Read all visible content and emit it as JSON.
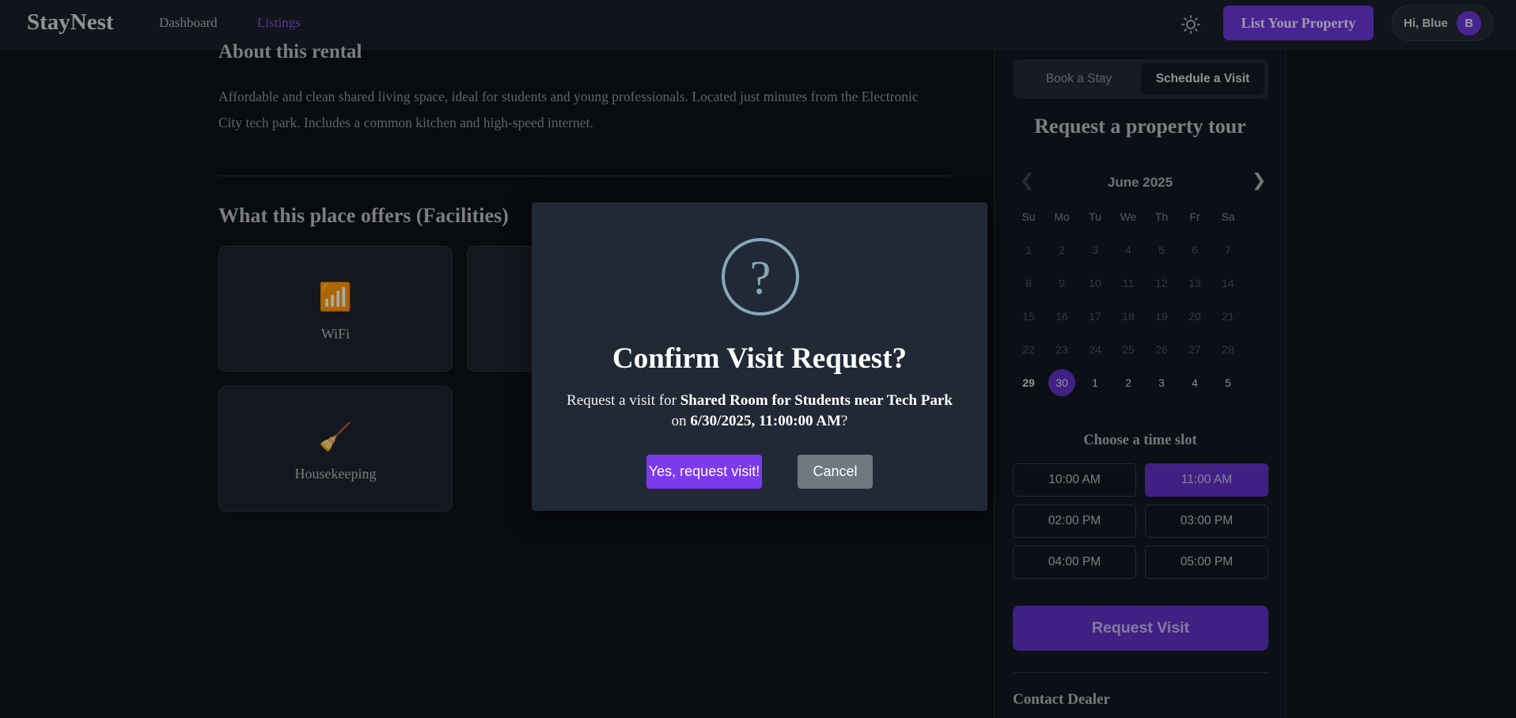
{
  "nav": {
    "brand": "StayNest",
    "links": [
      {
        "label": "Dashboard",
        "active": false
      },
      {
        "label": "Listings",
        "active": true
      }
    ],
    "theme_icon": "sun-icon",
    "list_button": "List Your Property",
    "user_greeting": "Hi, Blue",
    "user_initial": "B"
  },
  "main": {
    "about_title": "About this rental",
    "description": "Affordable and clean shared living space, ideal for students and young professionals. Located just minutes from the Electronic City tech park. Includes a common kitchen and high-speed internet.",
    "facilities_title": "What this place offers (Facilities)",
    "facilities": [
      {
        "label": "WiFi",
        "icon": "📶"
      },
      {
        "label": "",
        "icon": ""
      },
      {
        "label": "Housekeeping",
        "icon": "🧹"
      }
    ]
  },
  "sidebar": {
    "tabs": [
      "Book a Stay",
      "Schedule a Visit"
    ],
    "active_tab": "Schedule a Visit",
    "title": "Request a property tour",
    "calendar": {
      "month": "June 2025",
      "weekdays": [
        "Su",
        "Mo",
        "Tu",
        "We",
        "Th",
        "Fr",
        "Sa"
      ],
      "rows": [
        [
          "1",
          "2",
          "3",
          "4",
          "5",
          "6",
          "7"
        ],
        [
          "8",
          "9",
          "10",
          "11",
          "12",
          "13",
          "14"
        ],
        [
          "15",
          "16",
          "17",
          "18",
          "19",
          "20",
          "21"
        ],
        [
          "22",
          "23",
          "24",
          "25",
          "26",
          "27",
          "28"
        ],
        [
          "29",
          "30",
          "1",
          "2",
          "3",
          "4",
          "5"
        ]
      ],
      "today": "29",
      "selected": "30"
    },
    "slot_title": "Choose a time slot",
    "slots": [
      "10:00 AM",
      "11:00 AM",
      "02:00 PM",
      "03:00 PM",
      "04:00 PM",
      "05:00 PM"
    ],
    "selected_slot": "11:00 AM",
    "request_button": "Request Visit",
    "contact_title": "Contact Dealer"
  },
  "modal": {
    "icon": "question-icon",
    "title": "Confirm Visit Request?",
    "text_prefix": "Request a visit for ",
    "property": "Shared Room for Students near Tech Park",
    "text_mid": " on ",
    "datetime": "6/30/2025, 11:00:00 AM",
    "text_suffix": "?",
    "confirm": "Yes, request visit!",
    "cancel": "Cancel"
  },
  "colors": {
    "accent": "#6a36d6",
    "confirm_button": "#7c3aed",
    "cancel_button": "#6e7881",
    "modal_icon": "#87a7b8"
  }
}
